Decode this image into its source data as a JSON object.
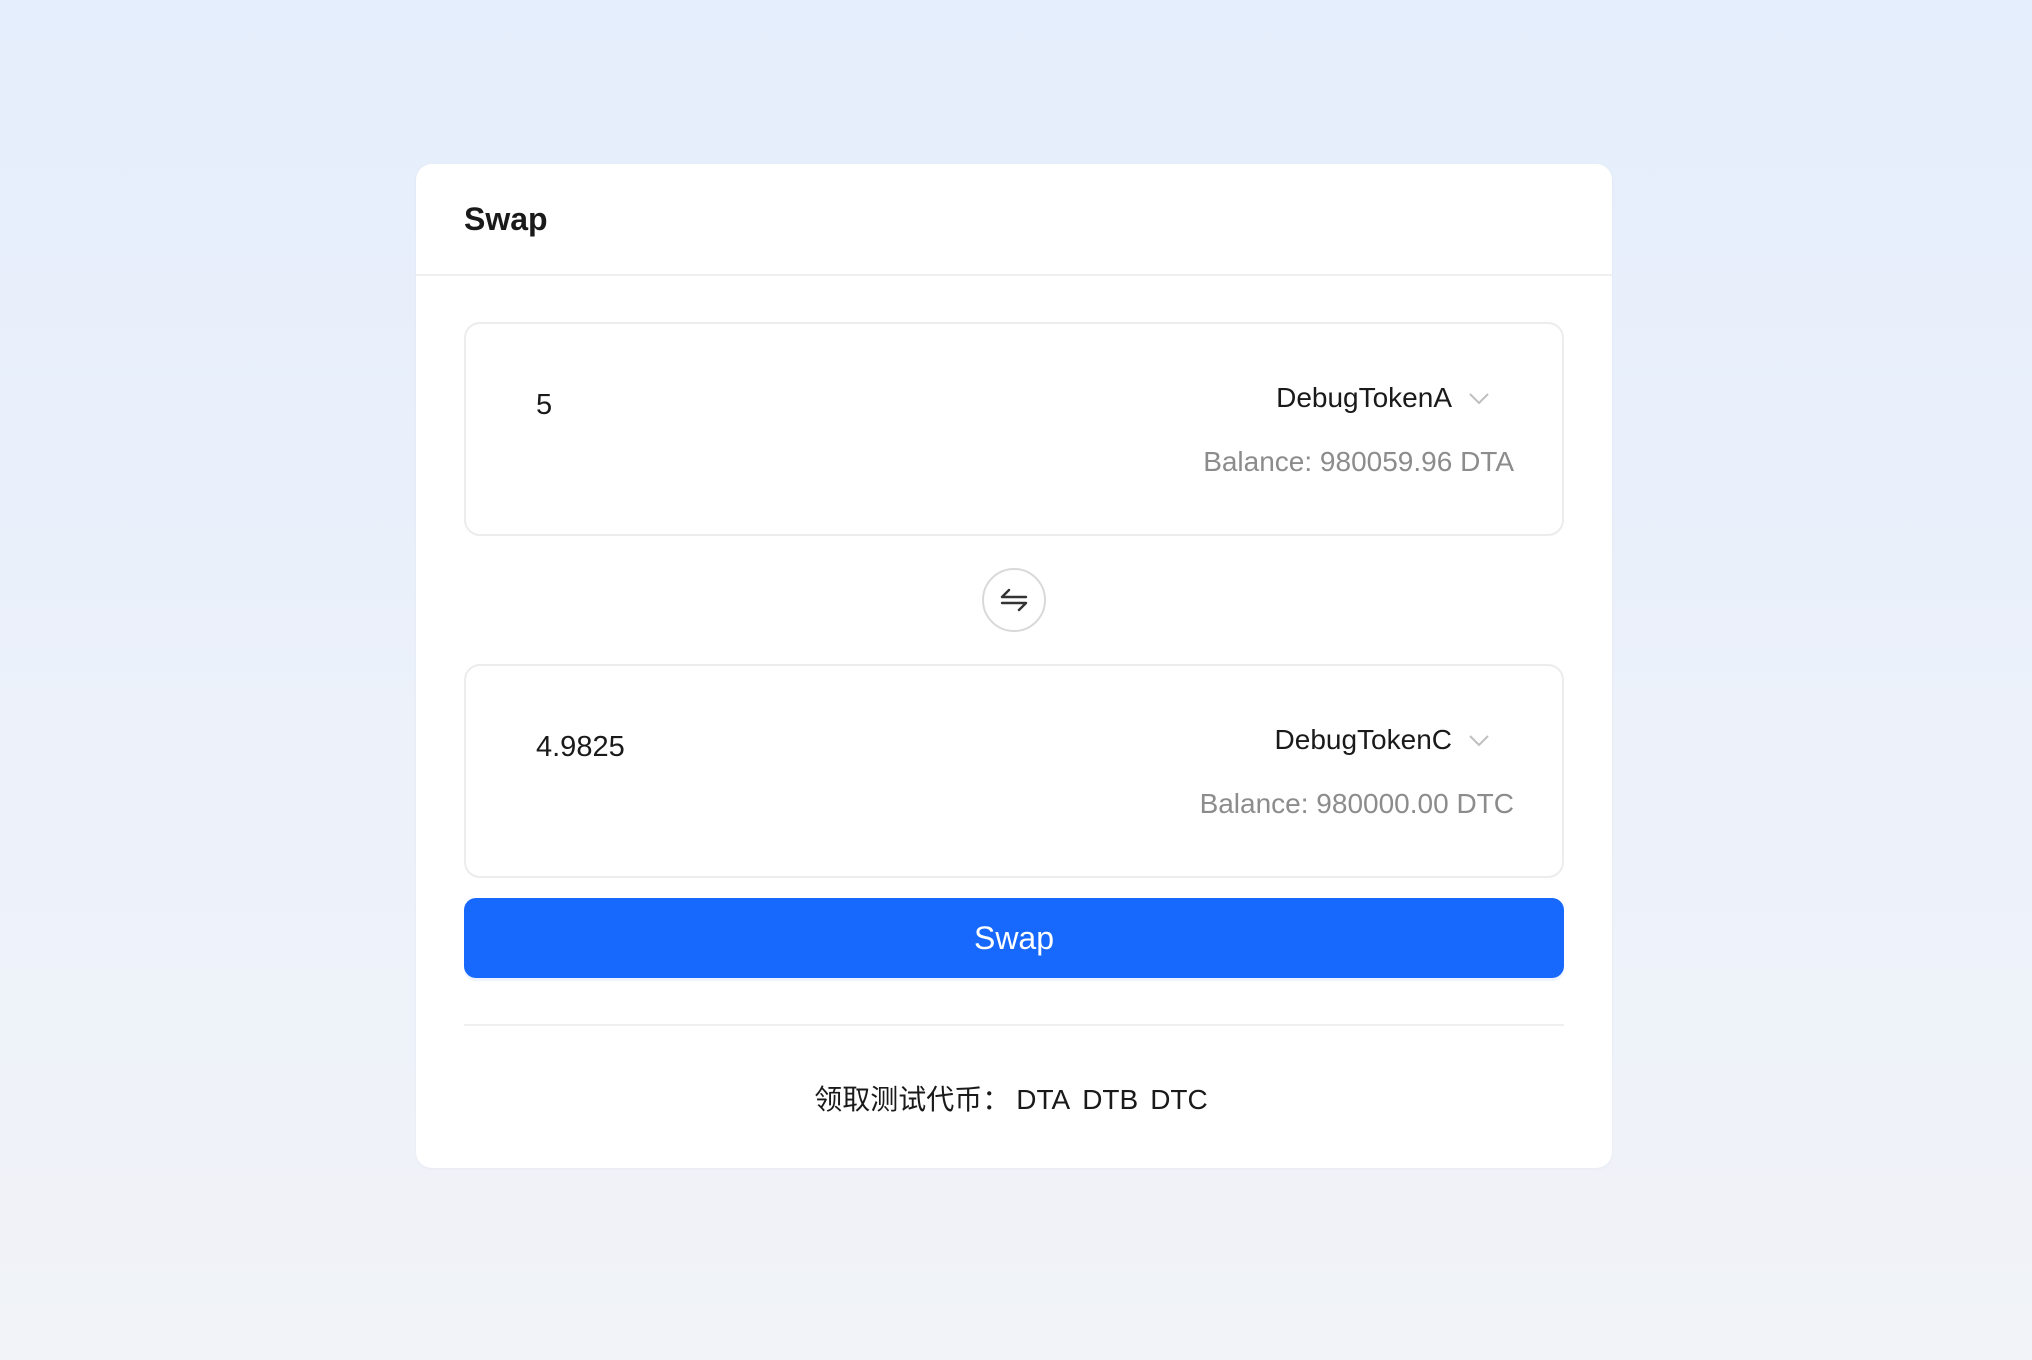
{
  "card": {
    "title": "Swap"
  },
  "from": {
    "amount": "5",
    "token": "DebugTokenA",
    "balance": "Balance: 980059.96 DTA"
  },
  "to": {
    "amount": "4.9825",
    "token": "DebugTokenC",
    "balance": "Balance: 980000.00 DTC"
  },
  "swap_button_label": "Swap",
  "faucet": {
    "label": "领取测试代币：",
    "tokens": [
      "DTA",
      "DTB",
      "DTC"
    ]
  },
  "colors": {
    "primary": "#1769fd",
    "muted_text": "#8c8c8c",
    "border": "#ececec"
  },
  "icons": {
    "switch": "swap-arrows-icon",
    "dropdown": "chevron-down-icon"
  }
}
